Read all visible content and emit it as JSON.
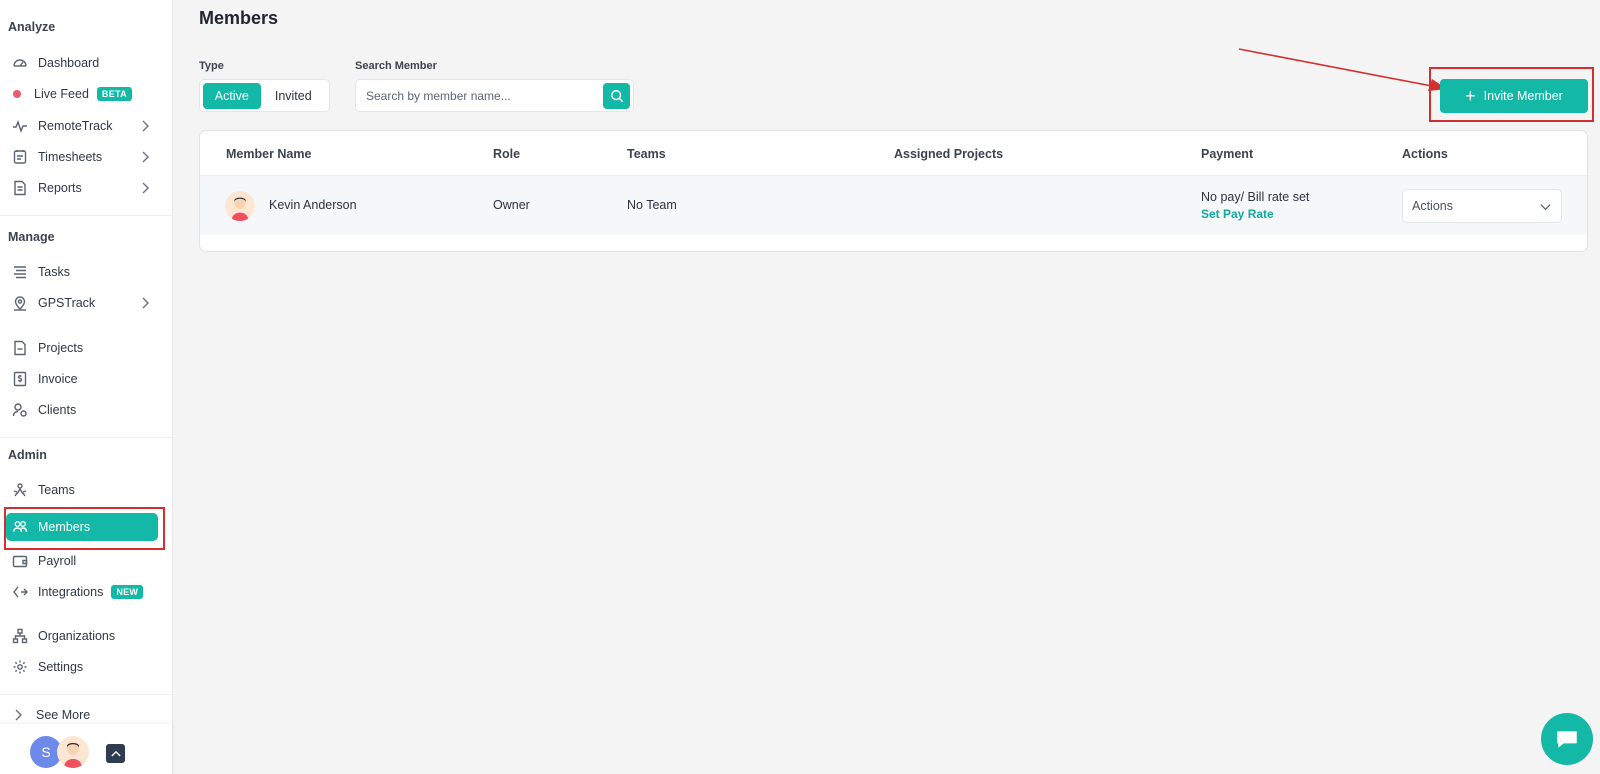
{
  "sidebar": {
    "sections": {
      "analyze": "Analyze",
      "manage": "Manage",
      "admin": "Admin"
    },
    "items": {
      "dashboard": "Dashboard",
      "live_feed": "Live Feed",
      "live_feed_badge": "BETA",
      "remotetrack": "RemoteTrack",
      "timesheets": "Timesheets",
      "reports": "Reports",
      "tasks": "Tasks",
      "gpstrack": "GPSTrack",
      "projects": "Projects",
      "invoice": "Invoice",
      "clients": "Clients",
      "teams": "Teams",
      "members": "Members",
      "payroll": "Payroll",
      "integrations": "Integrations",
      "integrations_badge": "NEW",
      "organizations": "Organizations",
      "settings": "Settings",
      "see_more": "See More"
    },
    "footer": {
      "avatar_initial": "S"
    }
  },
  "main": {
    "title": "Members",
    "type_label": "Type",
    "type_options": [
      "Active",
      "Invited"
    ],
    "type_selected": "Active",
    "search_label": "Search Member",
    "search_placeholder": "Search by member name...",
    "invite_button": "Invite Member",
    "table": {
      "headers": [
        "Member Name",
        "Role",
        "Teams",
        "Assigned Projects",
        "Payment",
        "Actions"
      ],
      "rows": [
        {
          "name": "Kevin Anderson",
          "role": "Owner",
          "teams": "No Team",
          "assigned_projects": "",
          "payment": "No pay/ Bill rate set",
          "payment_link": "Set Pay Rate",
          "actions": "Actions"
        }
      ]
    }
  },
  "colors": {
    "accent": "#14b8a6",
    "highlight": "#d32f2f"
  }
}
